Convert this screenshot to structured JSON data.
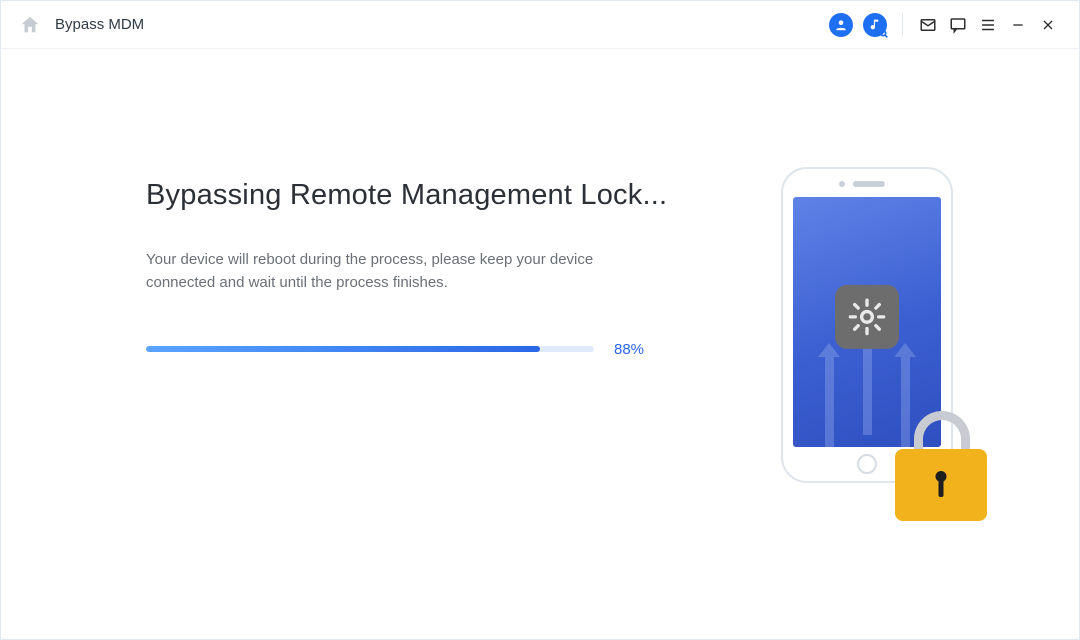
{
  "titlebar": {
    "title": "Bypass MDM",
    "icons": {
      "home": "home-icon",
      "account": "account-icon",
      "music_search": "music-search-icon",
      "mail": "mail-icon",
      "feedback": "feedback-icon",
      "menu": "menu-icon",
      "minimize": "minimize-icon",
      "close": "close-icon"
    }
  },
  "main": {
    "heading": "Bypassing Remote Management Lock...",
    "subtext": "Your device will reboot during the process, please keep your device connected and wait until the process finishes.",
    "progress": {
      "percent": 88,
      "label": "88%"
    }
  },
  "illustration": {
    "device": "iphone",
    "overlay_icon": "gear-icon",
    "lock_icon": "lock-icon"
  },
  "colors": {
    "accent": "#1f6ff2",
    "progress_start": "#5aa4ff",
    "progress_end": "#2a67e6",
    "lock": "#f2b21b"
  }
}
